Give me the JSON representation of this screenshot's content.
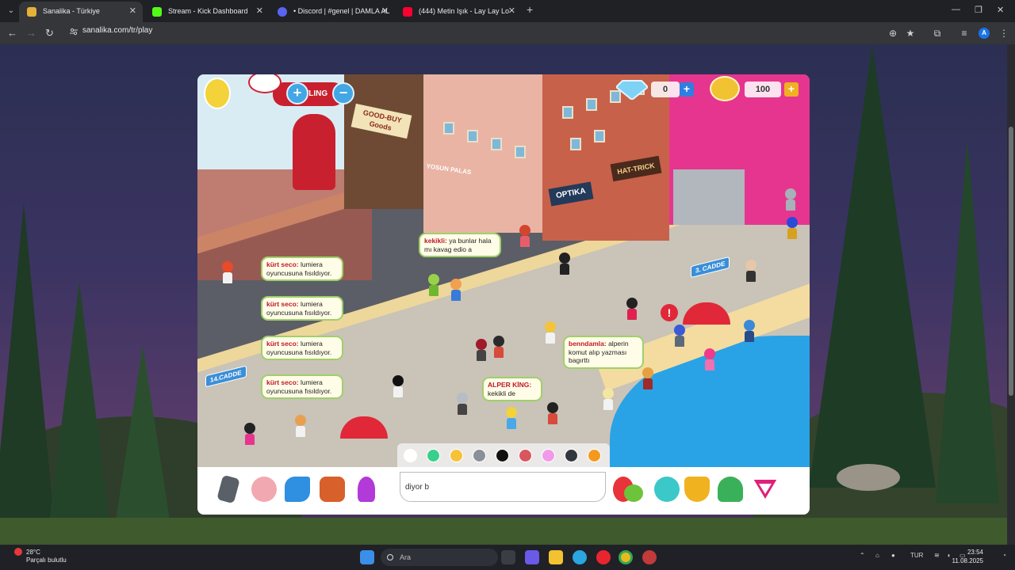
{
  "browser": {
    "tabs": [
      {
        "title": "Sanalika - Türkiye",
        "active": true
      },
      {
        "title": "Stream - Kick Dashboard",
        "active": false
      },
      {
        "title": "• Discord | #genel | DAMLA AL",
        "active": false
      },
      {
        "title": "(444) Metin Işık - Lay Lay Lo",
        "active": false
      }
    ],
    "url": "sanalika.com/tr/play"
  },
  "game": {
    "diamonds": "0",
    "coins": "100",
    "signs": {
      "bowling": "BOWLING",
      "goodbuy": "GOOD-BUY Goods",
      "yosun": "YOSUN PALAS",
      "optika": "OPTIKA",
      "hattrick": "HAT-TRICK",
      "street3": "3. CADDE",
      "street14": "14.CADDE"
    },
    "chat": [
      {
        "user": "kekikli:",
        "text": "ya bunlar hala mı kavag edio a"
      },
      {
        "user": "kürt seco:",
        "text": "lumiera oyuncusuna fısıldıyor."
      },
      {
        "user": "kürt seco:",
        "text": "lumiera oyuncusuna fısıldıyor."
      },
      {
        "user": "kürt seco:",
        "text": "lumiera oyuncusuna fısıldıyor."
      },
      {
        "user": "kürt seco:",
        "text": "lumiera oyuncusuna fısıldıyor."
      },
      {
        "user": "benndamla:",
        "text": "alperin komut alıp yazması bagırttı"
      },
      {
        "user": "ALPER KİNG:",
        "text": "kekikli de"
      }
    ],
    "input_value": "diyor b",
    "swatch_colors": [
      "#ffffff",
      "#39d08a",
      "#f6c23a",
      "#8a8f98",
      "#111111",
      "#d9565f",
      "#f09ae8",
      "#333840",
      "#f39a1e"
    ]
  },
  "taskbar": {
    "temp": "28°C",
    "weather": "Parçalı bulutlu",
    "search": "Ara",
    "lang": "TUR",
    "time": "23:54",
    "date": "11.08.2025"
  }
}
